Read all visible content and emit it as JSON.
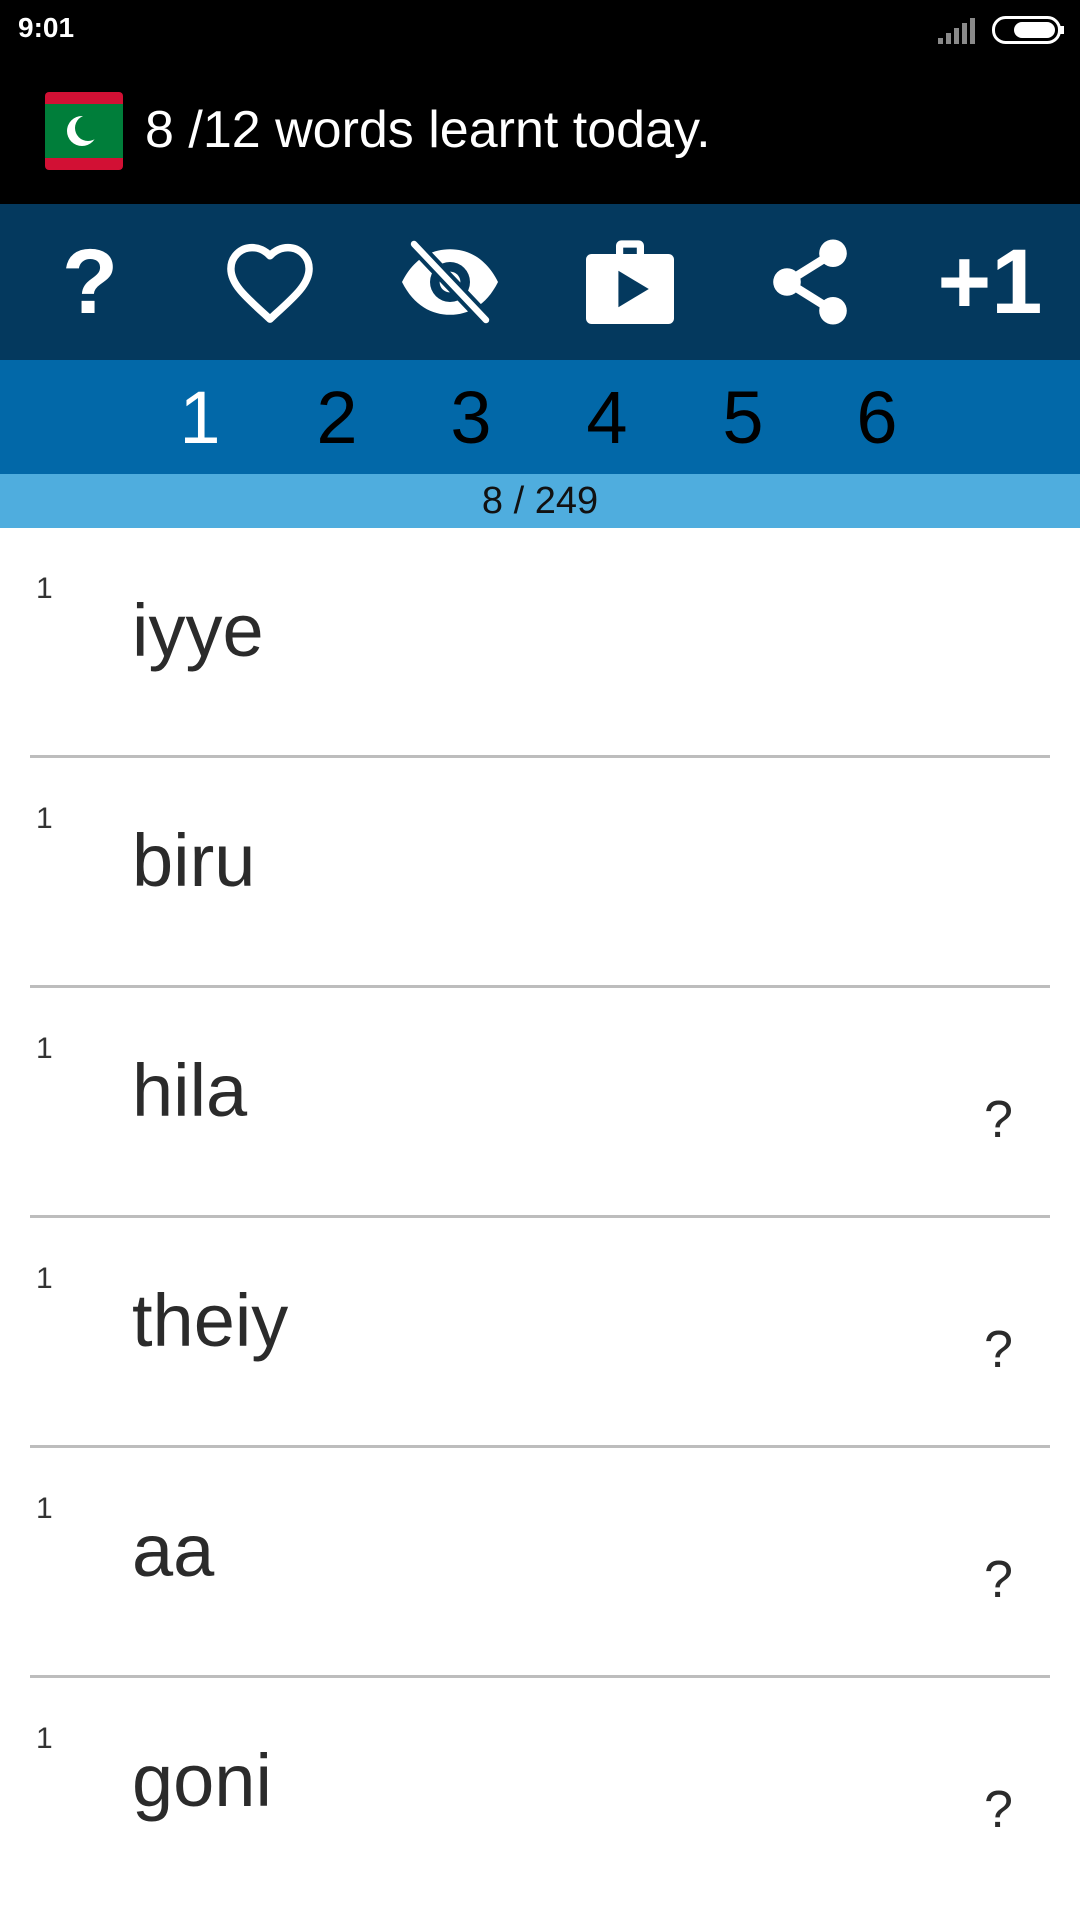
{
  "status_bar": {
    "time": "9:01"
  },
  "app_bar": {
    "title": "8 /12 words learnt today.",
    "flag_icon": "maldives-flag-icon",
    "colors": {
      "flag_red": "#d21034",
      "flag_green": "#007e3a"
    }
  },
  "toolbar": {
    "buttons": [
      {
        "name": "help",
        "icon": "question-icon",
        "label": "?"
      },
      {
        "name": "favorite",
        "icon": "heart-outline-icon"
      },
      {
        "name": "hide",
        "icon": "eye-off-icon"
      },
      {
        "name": "play-store",
        "icon": "play-briefcase-icon"
      },
      {
        "name": "share",
        "icon": "share-icon"
      },
      {
        "name": "plus-one",
        "icon": "plus-one-icon",
        "label": "+1"
      }
    ]
  },
  "level_tabs": {
    "items": [
      "1",
      "2",
      "3",
      "4",
      "5",
      "6"
    ],
    "selected": "1",
    "colors": {
      "selected": "#ffffff",
      "unselected": "#000000"
    }
  },
  "progress": {
    "text": "8 / 249"
  },
  "words": [
    {
      "level": "1",
      "word": "iyye",
      "hint": ""
    },
    {
      "level": "1",
      "word": "biru",
      "hint": ""
    },
    {
      "level": "1",
      "word": "hila",
      "hint": "?"
    },
    {
      "level": "1",
      "word": "theiy",
      "hint": "?"
    },
    {
      "level": "1",
      "word": "aa",
      "hint": "?"
    },
    {
      "level": "1",
      "word": "goni",
      "hint": "?"
    }
  ],
  "colors": {
    "status_bg": "#000000",
    "toolbar_bg": "#04395e",
    "tabs_bg": "#0268a8",
    "progress_bg": "#4fadde",
    "divider": "#bdbdbd"
  }
}
